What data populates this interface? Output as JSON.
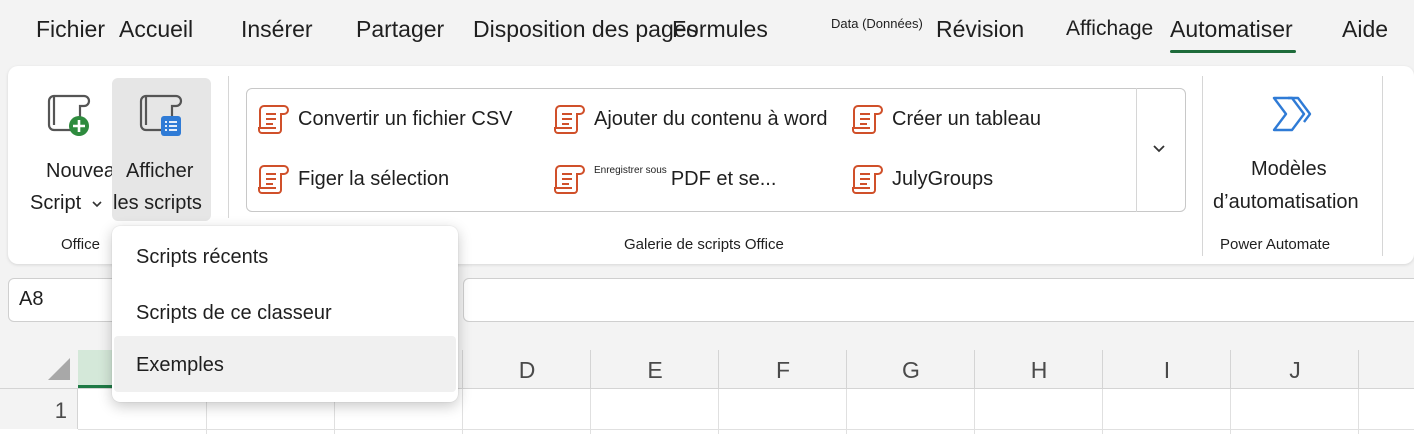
{
  "tabs": [
    {
      "label": "Fichier"
    },
    {
      "label": "Accueil"
    },
    {
      "label": "Insérer"
    },
    {
      "label": "Partager"
    },
    {
      "label": "Disposition des pages"
    },
    {
      "label": "Formules"
    },
    {
      "label": "Data (Données)"
    },
    {
      "label": "Révision"
    },
    {
      "label": "Affichage"
    },
    {
      "label": "Automatiser"
    },
    {
      "label": "Aide"
    }
  ],
  "ribbon": {
    "new_script": {
      "line1": "Nouveau",
      "line2": "Script"
    },
    "view_scripts": {
      "line1": "Afficher",
      "line2": "les scripts"
    },
    "office_group_label": "Office",
    "gallery": {
      "items": [
        {
          "label": "Convertir un fichier CSV"
        },
        {
          "label": "Ajouter du contenu à word"
        },
        {
          "label": "Créer un tableau"
        },
        {
          "label": "Figer la sélection"
        },
        {
          "small": "Enregistrer sous",
          "label": "PDF et se..."
        },
        {
          "label": "JulyGroups"
        }
      ],
      "group_label": "Galerie de scripts Office"
    },
    "power_automate": {
      "line1": "Modèles",
      "line2": "d’automatisation",
      "group_label": "Power Automate"
    }
  },
  "formula_bar": {
    "name_box": "A8"
  },
  "grid": {
    "columns": [
      "D",
      "E",
      "F",
      "G",
      "H",
      "I",
      "J"
    ],
    "rows": [
      "1"
    ]
  },
  "menu": {
    "items": [
      {
        "label": "Scripts récents"
      },
      {
        "label": "Scripts de ce classeur"
      },
      {
        "label": "Exemples"
      }
    ]
  },
  "colors": {
    "accent": "#1e6b3a",
    "script_icon": "#d0502a",
    "power_automate": "#2f7bd6"
  }
}
